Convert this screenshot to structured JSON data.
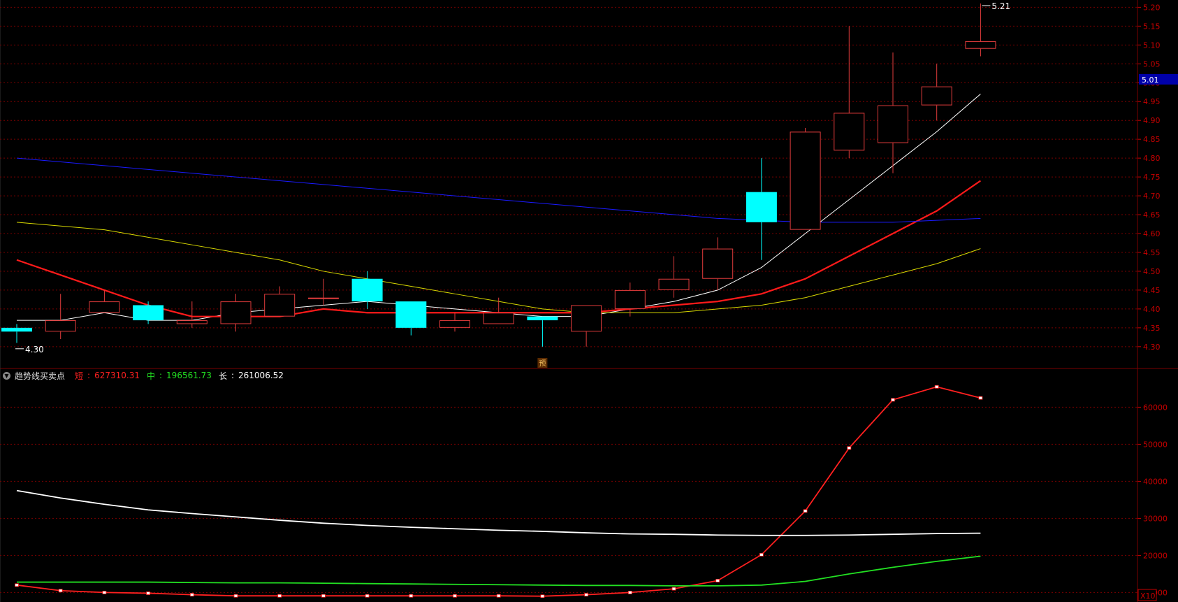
{
  "colors": {
    "background": "#000000",
    "grid": "#7a0000",
    "axis_text": "#c80000",
    "up_candle": "#e23c3c",
    "down_candle": "#00ffff",
    "ma5": "#ffffff",
    "ma10": "#ff1a1a",
    "ma20": "#d8d800",
    "ma60": "#1a1aff",
    "ind_short": "#ff2020",
    "ind_mid": "#22e022",
    "ind_long": "#ffffff",
    "price_tag_bg": "#0000aa"
  },
  "chart_data": [
    {
      "type": "candlestick",
      "ylim": [
        4.27,
        5.21
      ],
      "y_ticks": [
        "4.30",
        "4.35",
        "4.40",
        "4.45",
        "4.50",
        "4.55",
        "4.60",
        "4.65",
        "4.70",
        "4.75",
        "4.80",
        "4.85",
        "4.90",
        "4.95",
        "5.00",
        "5.05",
        "5.10",
        "5.15",
        "5.20"
      ],
      "grid": true,
      "candles": [
        {
          "o": 4.35,
          "h": 4.36,
          "l": 4.31,
          "c": 4.34
        },
        {
          "o": 4.34,
          "h": 4.44,
          "l": 4.32,
          "c": 4.37
        },
        {
          "o": 4.39,
          "h": 4.45,
          "l": 4.39,
          "c": 4.42
        },
        {
          "o": 4.41,
          "h": 4.42,
          "l": 4.36,
          "c": 4.37
        },
        {
          "o": 4.36,
          "h": 4.42,
          "l": 4.35,
          "c": 4.37
        },
        {
          "o": 4.36,
          "h": 4.44,
          "l": 4.34,
          "c": 4.42
        },
        {
          "o": 4.38,
          "h": 4.46,
          "l": 4.38,
          "c": 4.44
        },
        {
          "o": 4.43,
          "h": 4.48,
          "l": 4.41,
          "c": 4.43
        },
        {
          "o": 4.48,
          "h": 4.5,
          "l": 4.4,
          "c": 4.42
        },
        {
          "o": 4.42,
          "h": 4.42,
          "l": 4.33,
          "c": 4.35
        },
        {
          "o": 4.35,
          "h": 4.39,
          "l": 4.34,
          "c": 4.37
        },
        {
          "o": 4.36,
          "h": 4.43,
          "l": 4.36,
          "c": 4.39
        },
        {
          "o": 4.38,
          "h": 4.38,
          "l": 4.3,
          "c": 4.37
        },
        {
          "o": 4.34,
          "h": 4.41,
          "l": 4.3,
          "c": 4.41
        },
        {
          "o": 4.4,
          "h": 4.47,
          "l": 4.38,
          "c": 4.45
        },
        {
          "o": 4.45,
          "h": 4.54,
          "l": 4.43,
          "c": 4.48
        },
        {
          "o": 4.48,
          "h": 4.59,
          "l": 4.45,
          "c": 4.56
        },
        {
          "o": 4.71,
          "h": 4.8,
          "l": 4.53,
          "c": 4.63
        },
        {
          "o": 4.61,
          "h": 4.88,
          "l": 4.61,
          "c": 4.87
        },
        {
          "o": 4.82,
          "h": 5.15,
          "l": 4.8,
          "c": 4.92
        },
        {
          "o": 4.84,
          "h": 5.08,
          "l": 4.76,
          "c": 4.94
        },
        {
          "o": 4.94,
          "h": 5.05,
          "l": 4.9,
          "c": 4.99
        },
        {
          "o": 5.09,
          "h": 5.21,
          "l": 5.07,
          "c": 5.11
        }
      ],
      "series": [
        {
          "values": [
            4.37,
            4.37,
            4.39,
            4.37,
            4.37,
            4.39,
            4.4,
            4.41,
            4.42,
            4.41,
            4.4,
            4.39,
            4.38,
            4.38,
            4.4,
            4.42,
            4.45,
            4.51,
            4.6,
            4.69,
            4.78,
            4.87,
            4.97
          ]
        },
        {
          "values": [
            4.53,
            4.49,
            4.45,
            4.41,
            4.38,
            4.38,
            4.38,
            4.4,
            4.39,
            4.39,
            4.39,
            4.39,
            4.39,
            4.39,
            4.4,
            4.41,
            4.42,
            4.44,
            4.48,
            4.54,
            4.6,
            4.66,
            4.74
          ]
        },
        {
          "values": [
            4.63,
            4.62,
            4.61,
            4.59,
            4.57,
            4.55,
            4.53,
            4.5,
            4.48,
            4.46,
            4.44,
            4.42,
            4.4,
            4.39,
            4.39,
            4.39,
            4.4,
            4.41,
            4.43,
            4.46,
            4.49,
            4.52,
            4.56
          ]
        },
        {
          "values": [
            4.8,
            4.79,
            4.78,
            4.77,
            4.76,
            4.75,
            4.74,
            4.73,
            4.72,
            4.71,
            4.7,
            4.69,
            4.68,
            4.67,
            4.66,
            4.65,
            4.64,
            4.635,
            4.63,
            4.63,
            4.63,
            4.635,
            4.64
          ]
        }
      ],
      "annotations": {
        "low_label": "4.30",
        "high_label": "5.21",
        "signal_label": "预",
        "current_price": "5.01"
      }
    },
    {
      "type": "line",
      "title": "趋势线买卖点",
      "ylim": [
        8000,
        68000
      ],
      "y_ticks": [
        "10000",
        "20000",
        "30000",
        "40000",
        "50000",
        "60000"
      ],
      "scale_label": "X10",
      "grid": true,
      "series": [
        {
          "name": "短",
          "display_value": "627310.31",
          "values": [
            12000,
            10500,
            10000,
            9800,
            9400,
            9100,
            9100,
            9100,
            9100,
            9100,
            9100,
            9100,
            9000,
            9400,
            10000,
            11000,
            13200,
            20200,
            32000,
            49000,
            62000,
            65500,
            62500
          ]
        },
        {
          "name": "中",
          "display_value": "196561.73",
          "values": [
            12800,
            12800,
            12800,
            12800,
            12700,
            12600,
            12600,
            12500,
            12400,
            12300,
            12200,
            12100,
            12000,
            11900,
            11900,
            11800,
            11800,
            12000,
            13000,
            15000,
            16800,
            18400,
            19800
          ]
        },
        {
          "name": "长",
          "display_value": "261006.52",
          "values": [
            37500,
            35500,
            33800,
            32300,
            31300,
            30400,
            29500,
            28700,
            28100,
            27600,
            27200,
            26800,
            26500,
            26100,
            25800,
            25700,
            25500,
            25400,
            25400,
            25500,
            25700,
            25900,
            26000
          ]
        }
      ]
    }
  ]
}
